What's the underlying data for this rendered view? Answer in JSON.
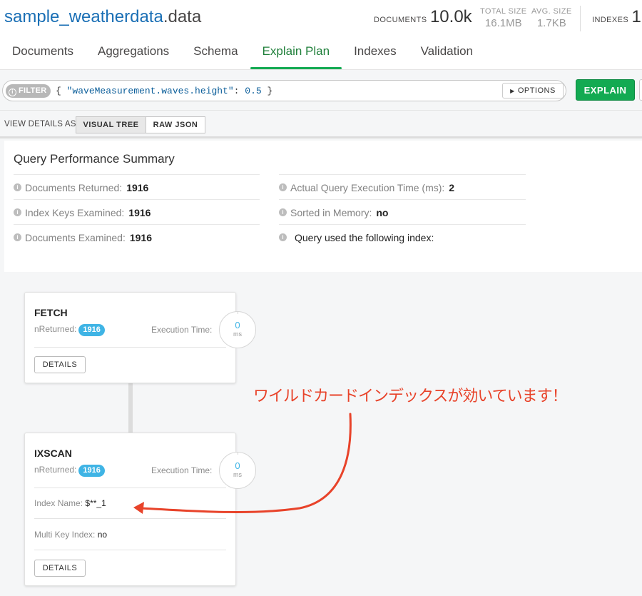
{
  "namespace": {
    "db": "sample_weatherdata",
    "collection": ".data"
  },
  "stats": {
    "documents_label": "DOCUMENTS",
    "documents_value": "10.0k",
    "total_size_label": "TOTAL SIZE",
    "total_size_value": "16.1MB",
    "avg_size_label": "AVG. SIZE",
    "avg_size_value": "1.7KB",
    "indexes_label": "INDEXES",
    "indexes_value": "1"
  },
  "tabs": [
    {
      "label": "Documents"
    },
    {
      "label": "Aggregations"
    },
    {
      "label": "Schema"
    },
    {
      "label": "Explain Plan"
    },
    {
      "label": "Indexes"
    },
    {
      "label": "Validation"
    }
  ],
  "query": {
    "filter_label": "FILTER",
    "filter_open": "{ ",
    "filter_key": "\"waveMeasurement.waves.height\"",
    "filter_colon": ": ",
    "filter_value": "0.5",
    "filter_close": " }",
    "options_label": "OPTIONS",
    "explain_label": "EXPLAIN"
  },
  "view": {
    "label": "VIEW DETAILS AS",
    "visual_tree": "VISUAL TREE",
    "raw_json": "RAW JSON"
  },
  "summary": {
    "title": "Query Performance Summary",
    "docs_returned_label": "Documents Returned:",
    "docs_returned_value": "1916",
    "keys_examined_label": "Index Keys Examined:",
    "keys_examined_value": "1916",
    "docs_examined_label": "Documents Examined:",
    "docs_examined_value": "1916",
    "exec_time_label": "Actual Query Execution Time (ms):",
    "exec_time_value": "2",
    "sorted_label": "Sorted in Memory:",
    "sorted_value": "no",
    "index_used_label": "Query used the following index:"
  },
  "stages": {
    "fetch": {
      "name": "FETCH",
      "nreturned_label": "nReturned:",
      "nreturned_value": "1916",
      "exec_label": "Execution Time:",
      "exec_value": "0",
      "exec_unit": "ms",
      "details_label": "DETAILS"
    },
    "ixscan": {
      "name": "IXSCAN",
      "nreturned_label": "nReturned:",
      "nreturned_value": "1916",
      "exec_label": "Execution Time:",
      "exec_value": "0",
      "exec_unit": "ms",
      "index_name_label": "Index Name:",
      "index_name_value": "$**_1",
      "multikey_label": "Multi Key Index:",
      "multikey_value": "no",
      "details_label": "DETAILS"
    }
  },
  "annotation": {
    "text": "ワイルドカードインデックスが効いています！",
    "color": "#e8432a"
  },
  "colors": {
    "accent_green": "#13aa52",
    "pill_blue": "#3fb4e5",
    "link_blue": "#1a6fb5"
  }
}
